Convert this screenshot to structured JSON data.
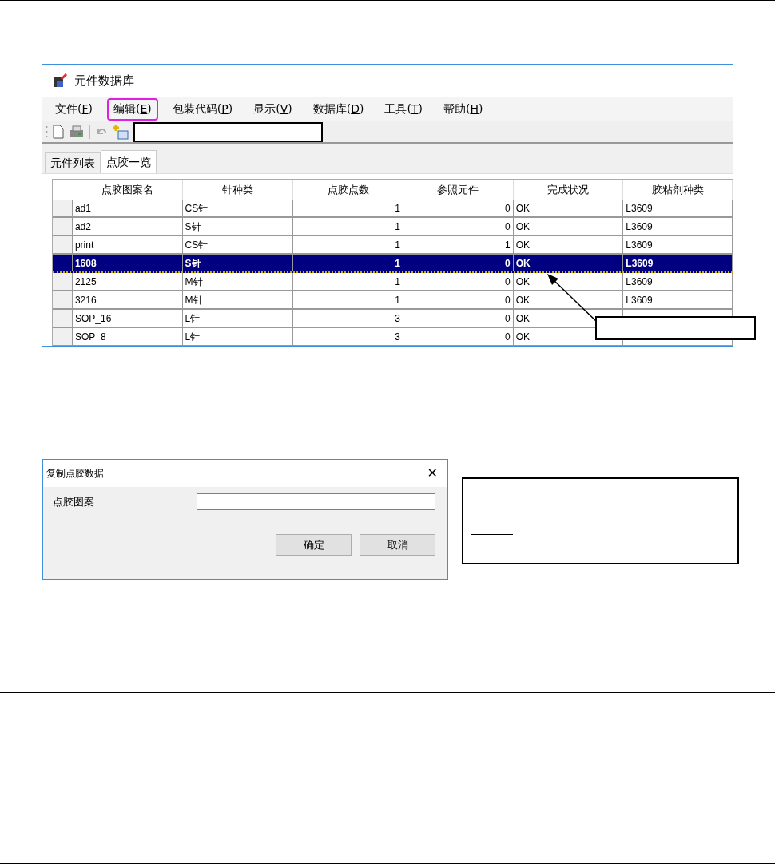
{
  "window": {
    "title": "元件数据库"
  },
  "menu": [
    {
      "label": "文件(",
      "key": "F",
      "end": ")",
      "highlighted": false
    },
    {
      "label": "编辑(",
      "key": "E",
      "end": ")",
      "highlighted": true
    },
    {
      "label": "包装代码(",
      "key": "P",
      "end": ")",
      "highlighted": false
    },
    {
      "label": "显示(",
      "key": "V",
      "end": ")",
      "highlighted": false
    },
    {
      "label": "数据库(",
      "key": "D",
      "end": ")",
      "highlighted": false
    },
    {
      "label": "工具(",
      "key": "T",
      "end": ")",
      "highlighted": false
    },
    {
      "label": "帮助(",
      "key": "H",
      "end": ")",
      "highlighted": false
    }
  ],
  "tabs": [
    {
      "label": "元件列表",
      "selected": false
    },
    {
      "label": "点胶一览",
      "selected": true
    }
  ],
  "table": {
    "columns": [
      "点胶图案名",
      "针种类",
      "点胶点数",
      "参照元件",
      "完成状况",
      "胶粘剂种类"
    ],
    "rows": [
      {
        "name": "ad1",
        "needle": "CS针",
        "points": "1",
        "refs": "0",
        "status": "OK",
        "glue": "L3609",
        "selected": false
      },
      {
        "name": "ad2",
        "needle": "S针",
        "points": "1",
        "refs": "0",
        "status": "OK",
        "glue": "L3609",
        "selected": false
      },
      {
        "name": "print",
        "needle": "CS针",
        "points": "1",
        "refs": "1",
        "status": "OK",
        "glue": "L3609",
        "selected": false
      },
      {
        "name": "1608",
        "needle": "S针",
        "points": "1",
        "refs": "0",
        "status": "OK",
        "glue": "L3609",
        "selected": true
      },
      {
        "name": "2125",
        "needle": "M针",
        "points": "1",
        "refs": "0",
        "status": "OK",
        "glue": "L3609",
        "selected": false
      },
      {
        "name": "3216",
        "needle": "M针",
        "points": "1",
        "refs": "0",
        "status": "OK",
        "glue": "L3609",
        "selected": false
      },
      {
        "name": "SOP_16",
        "needle": "L针",
        "points": "3",
        "refs": "0",
        "status": "OK",
        "selected": false
      },
      {
        "name": "SOP_8",
        "needle": "L针",
        "points": "3",
        "refs": "0",
        "status": "OK",
        "selected": false
      }
    ]
  },
  "dialog": {
    "title": "复制点胶数据",
    "close": "✕",
    "field_label": "点胶图案",
    "buttons": [
      "确定",
      "取消"
    ]
  }
}
